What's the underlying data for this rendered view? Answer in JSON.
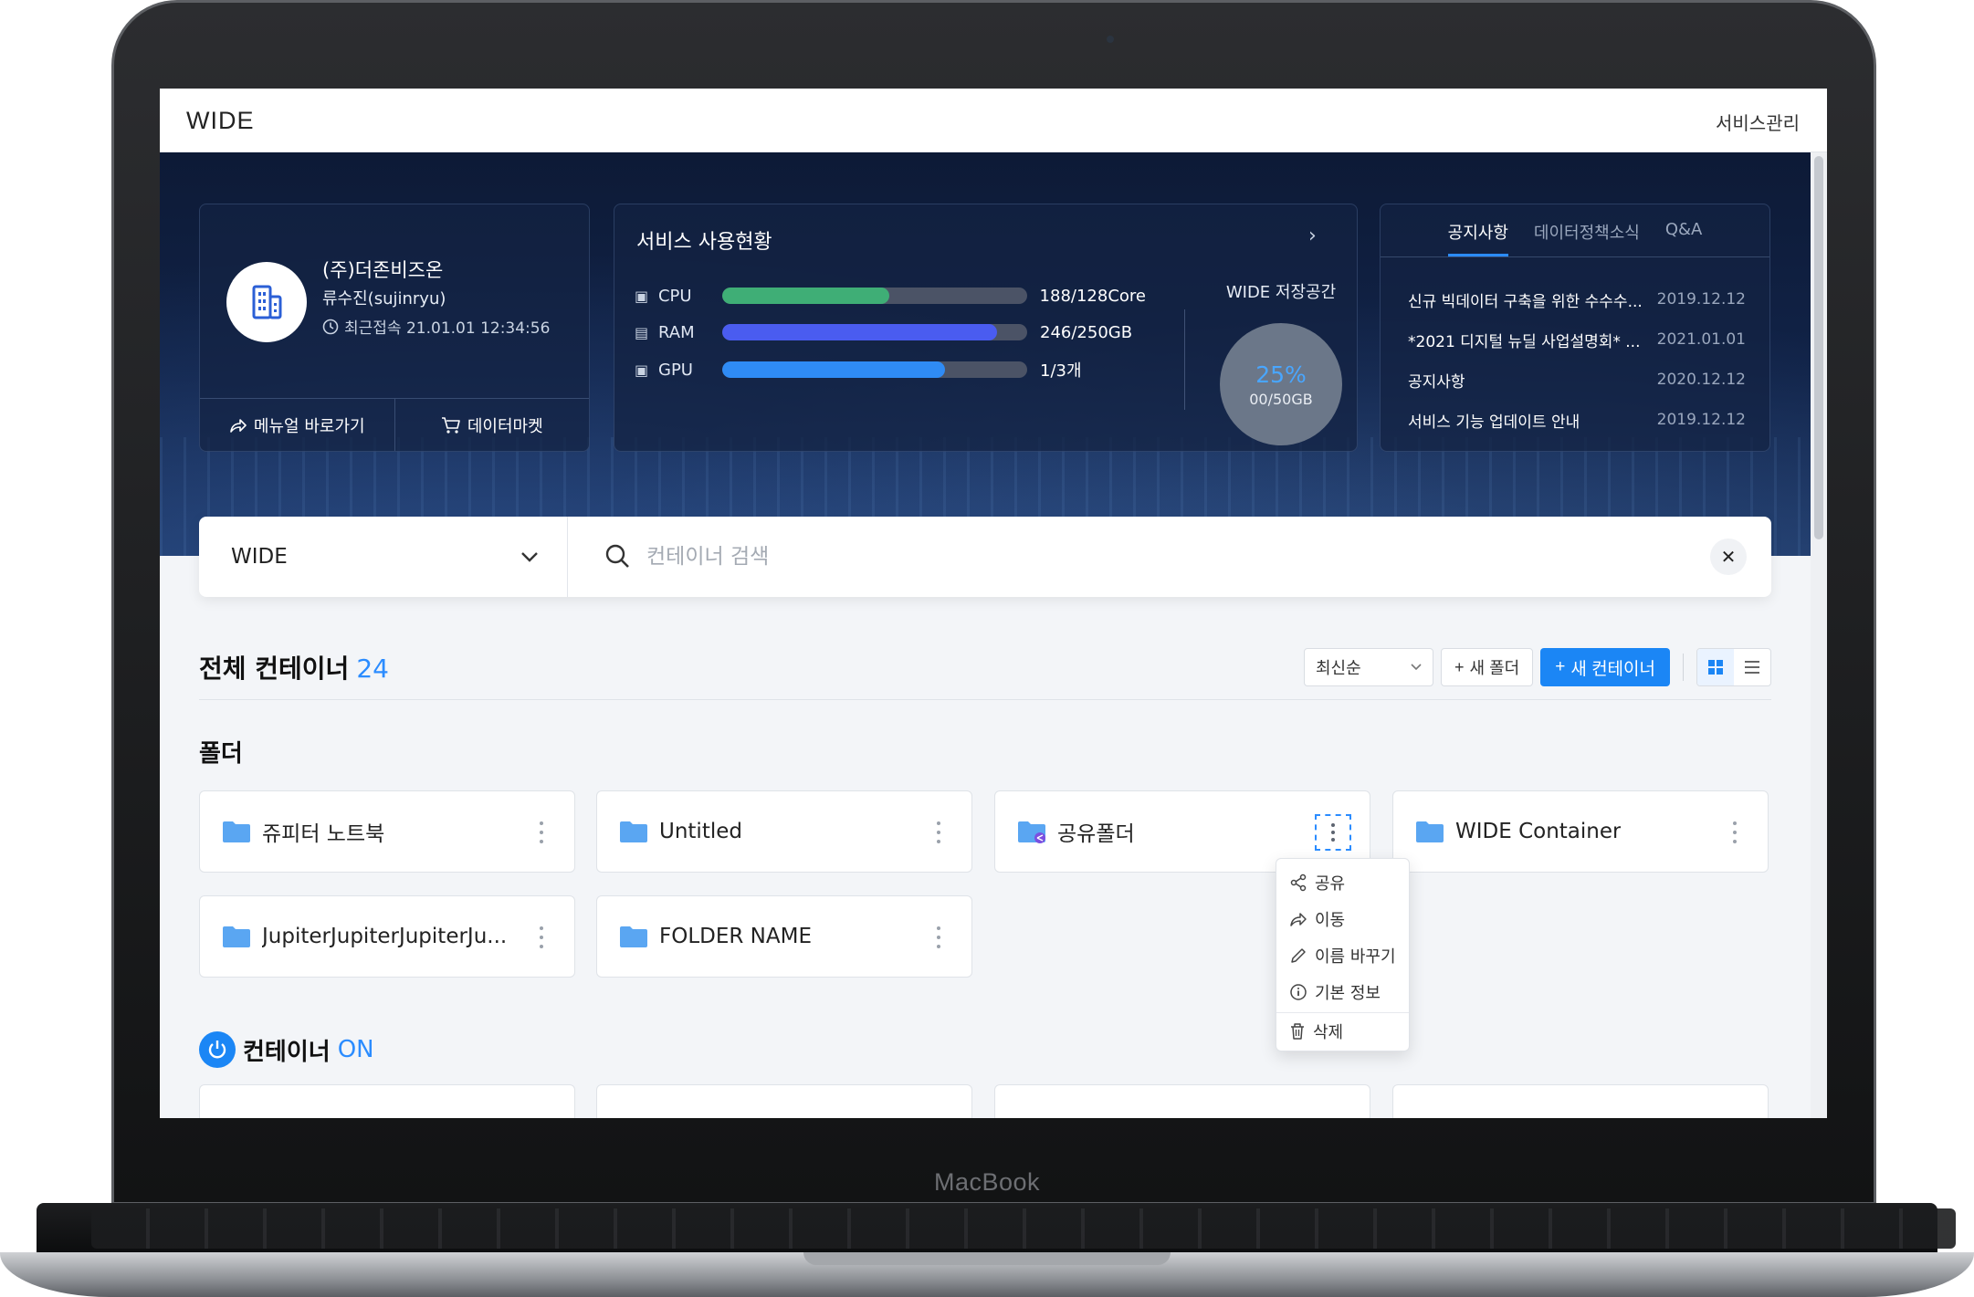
{
  "device": {
    "brand": "MacBook"
  },
  "app": {
    "logo": "WIDE",
    "admin_link": "서비스관리"
  },
  "profile": {
    "company": "(주)더존비즈온",
    "user": "류수진(sujinryu)",
    "last_login": "최근접속 21.01.01 12:34:56",
    "manual_link": "메뉴얼 바로가기",
    "data_market": "데이터마켓"
  },
  "usage": {
    "title": "서비스 사용현황",
    "resources": [
      {
        "label": "CPU",
        "value": "188/128Core",
        "fill": 0.55,
        "color": "#3fae76"
      },
      {
        "label": "RAM",
        "value": "246/250GB",
        "fill": 0.9,
        "color": "#4a5cf0"
      },
      {
        "label": "GPU",
        "value": "1/3개",
        "fill": 0.73,
        "color": "#2f8bf5"
      }
    ],
    "storage": {
      "label": "WIDE 저장공간",
      "percent": "25%",
      "size": "00/50GB"
    }
  },
  "notice": {
    "tabs": [
      "공지사항",
      "데이터정책소식",
      "Q&A"
    ],
    "active_tab": "공지사항",
    "items": [
      {
        "title": "신규 빅데이터 구축을 위한 수수수...",
        "date": "2019.12.12"
      },
      {
        "title": "*2021 디지털 뉴딜 사업설명회* ...",
        "date": "2021.01.01"
      },
      {
        "title": "공지사항",
        "date": "2020.12.12"
      },
      {
        "title": "서비스 기능 업데이트 안내",
        "date": "2019.12.12"
      }
    ]
  },
  "search": {
    "scope": "WIDE",
    "placeholder": "컨테이너 검색"
  },
  "containers": {
    "title": "전체 컨테이너",
    "count": "24",
    "sort": "최신순",
    "new_folder": "새 폴더",
    "new_container": "새 컨테이너",
    "view_mode": "grid"
  },
  "folders": {
    "heading": "폴더",
    "items": [
      {
        "name": "쥬피터 노트북",
        "shared": false
      },
      {
        "name": "Untitled",
        "shared": false
      },
      {
        "name": "공유폴더",
        "shared": true
      },
      {
        "name": "WIDE Container",
        "shared": false
      },
      {
        "name": "JupiterJupiterJupiterJu...",
        "shared": false
      },
      {
        "name": "FOLDER NAME",
        "shared": false
      }
    ]
  },
  "context_menu": {
    "items": [
      {
        "label": "공유",
        "icon": "share-icon"
      },
      {
        "label": "이동",
        "icon": "move-arrow-icon"
      },
      {
        "label": "이름 바꾸기",
        "icon": "pencil-icon"
      },
      {
        "label": "기본 정보",
        "icon": "info-icon"
      },
      {
        "label": "삭제",
        "icon": "trash-icon"
      }
    ]
  },
  "container_on": {
    "label": "컨테이너",
    "accent": "ON"
  },
  "colors": {
    "primary": "#1b86f5",
    "accent_text": "#2b8cff",
    "hero": "#112348"
  }
}
